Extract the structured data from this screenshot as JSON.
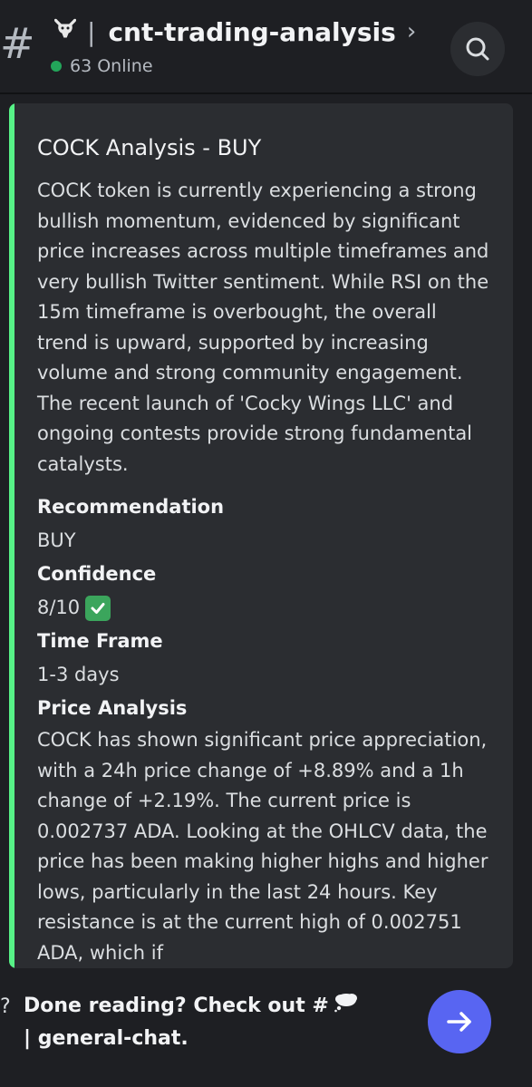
{
  "header": {
    "hash_symbol": "#",
    "channel_separator": "|",
    "channel_name": "cnt-trading-analysis",
    "chevron": "›",
    "online_count": "63 Online",
    "search_icon": "search-icon",
    "emoji_icon": "bull-emoji-icon"
  },
  "embed": {
    "accent_color": "#57f287",
    "title": "COCK Analysis - BUY",
    "description": "COCK token is currently experiencing a strong bullish momentum, evidenced by significant price increases across multiple timeframes and very bullish Twitter sentiment. While RSI on the 15m timeframe is overbought, the overall trend is upward, supported by increasing volume and strong community engagement. The recent launch of 'Cocky Wings LLC' and ongoing contests provide strong fundamental catalysts.",
    "fields": [
      {
        "name": "Recommendation",
        "value": "BUY"
      },
      {
        "name": "Confidence",
        "value": "8/10"
      },
      {
        "name": "Time Frame",
        "value": "1-3 days"
      },
      {
        "name": "Price Analysis",
        "value": "COCK has shown significant price appreciation, with a 24h price change of +8.89% and a 1h change of +2.19%. The current price is 0.002737 ADA. Looking at the OHLCV data, the price has been making higher highs and higher lows, particularly in the last 24 hours. Key resistance is at the current high of 0.002751 ADA, which if"
      }
    ],
    "confidence_icon": "check-mark-icon"
  },
  "footer": {
    "prefix_mark": "?",
    "done_text_start": "Done reading? Check out #",
    "done_text_end": "| general-chat.",
    "cloud_icon": "thought-cloud-icon",
    "jump_icon": "arrow-right-icon"
  }
}
